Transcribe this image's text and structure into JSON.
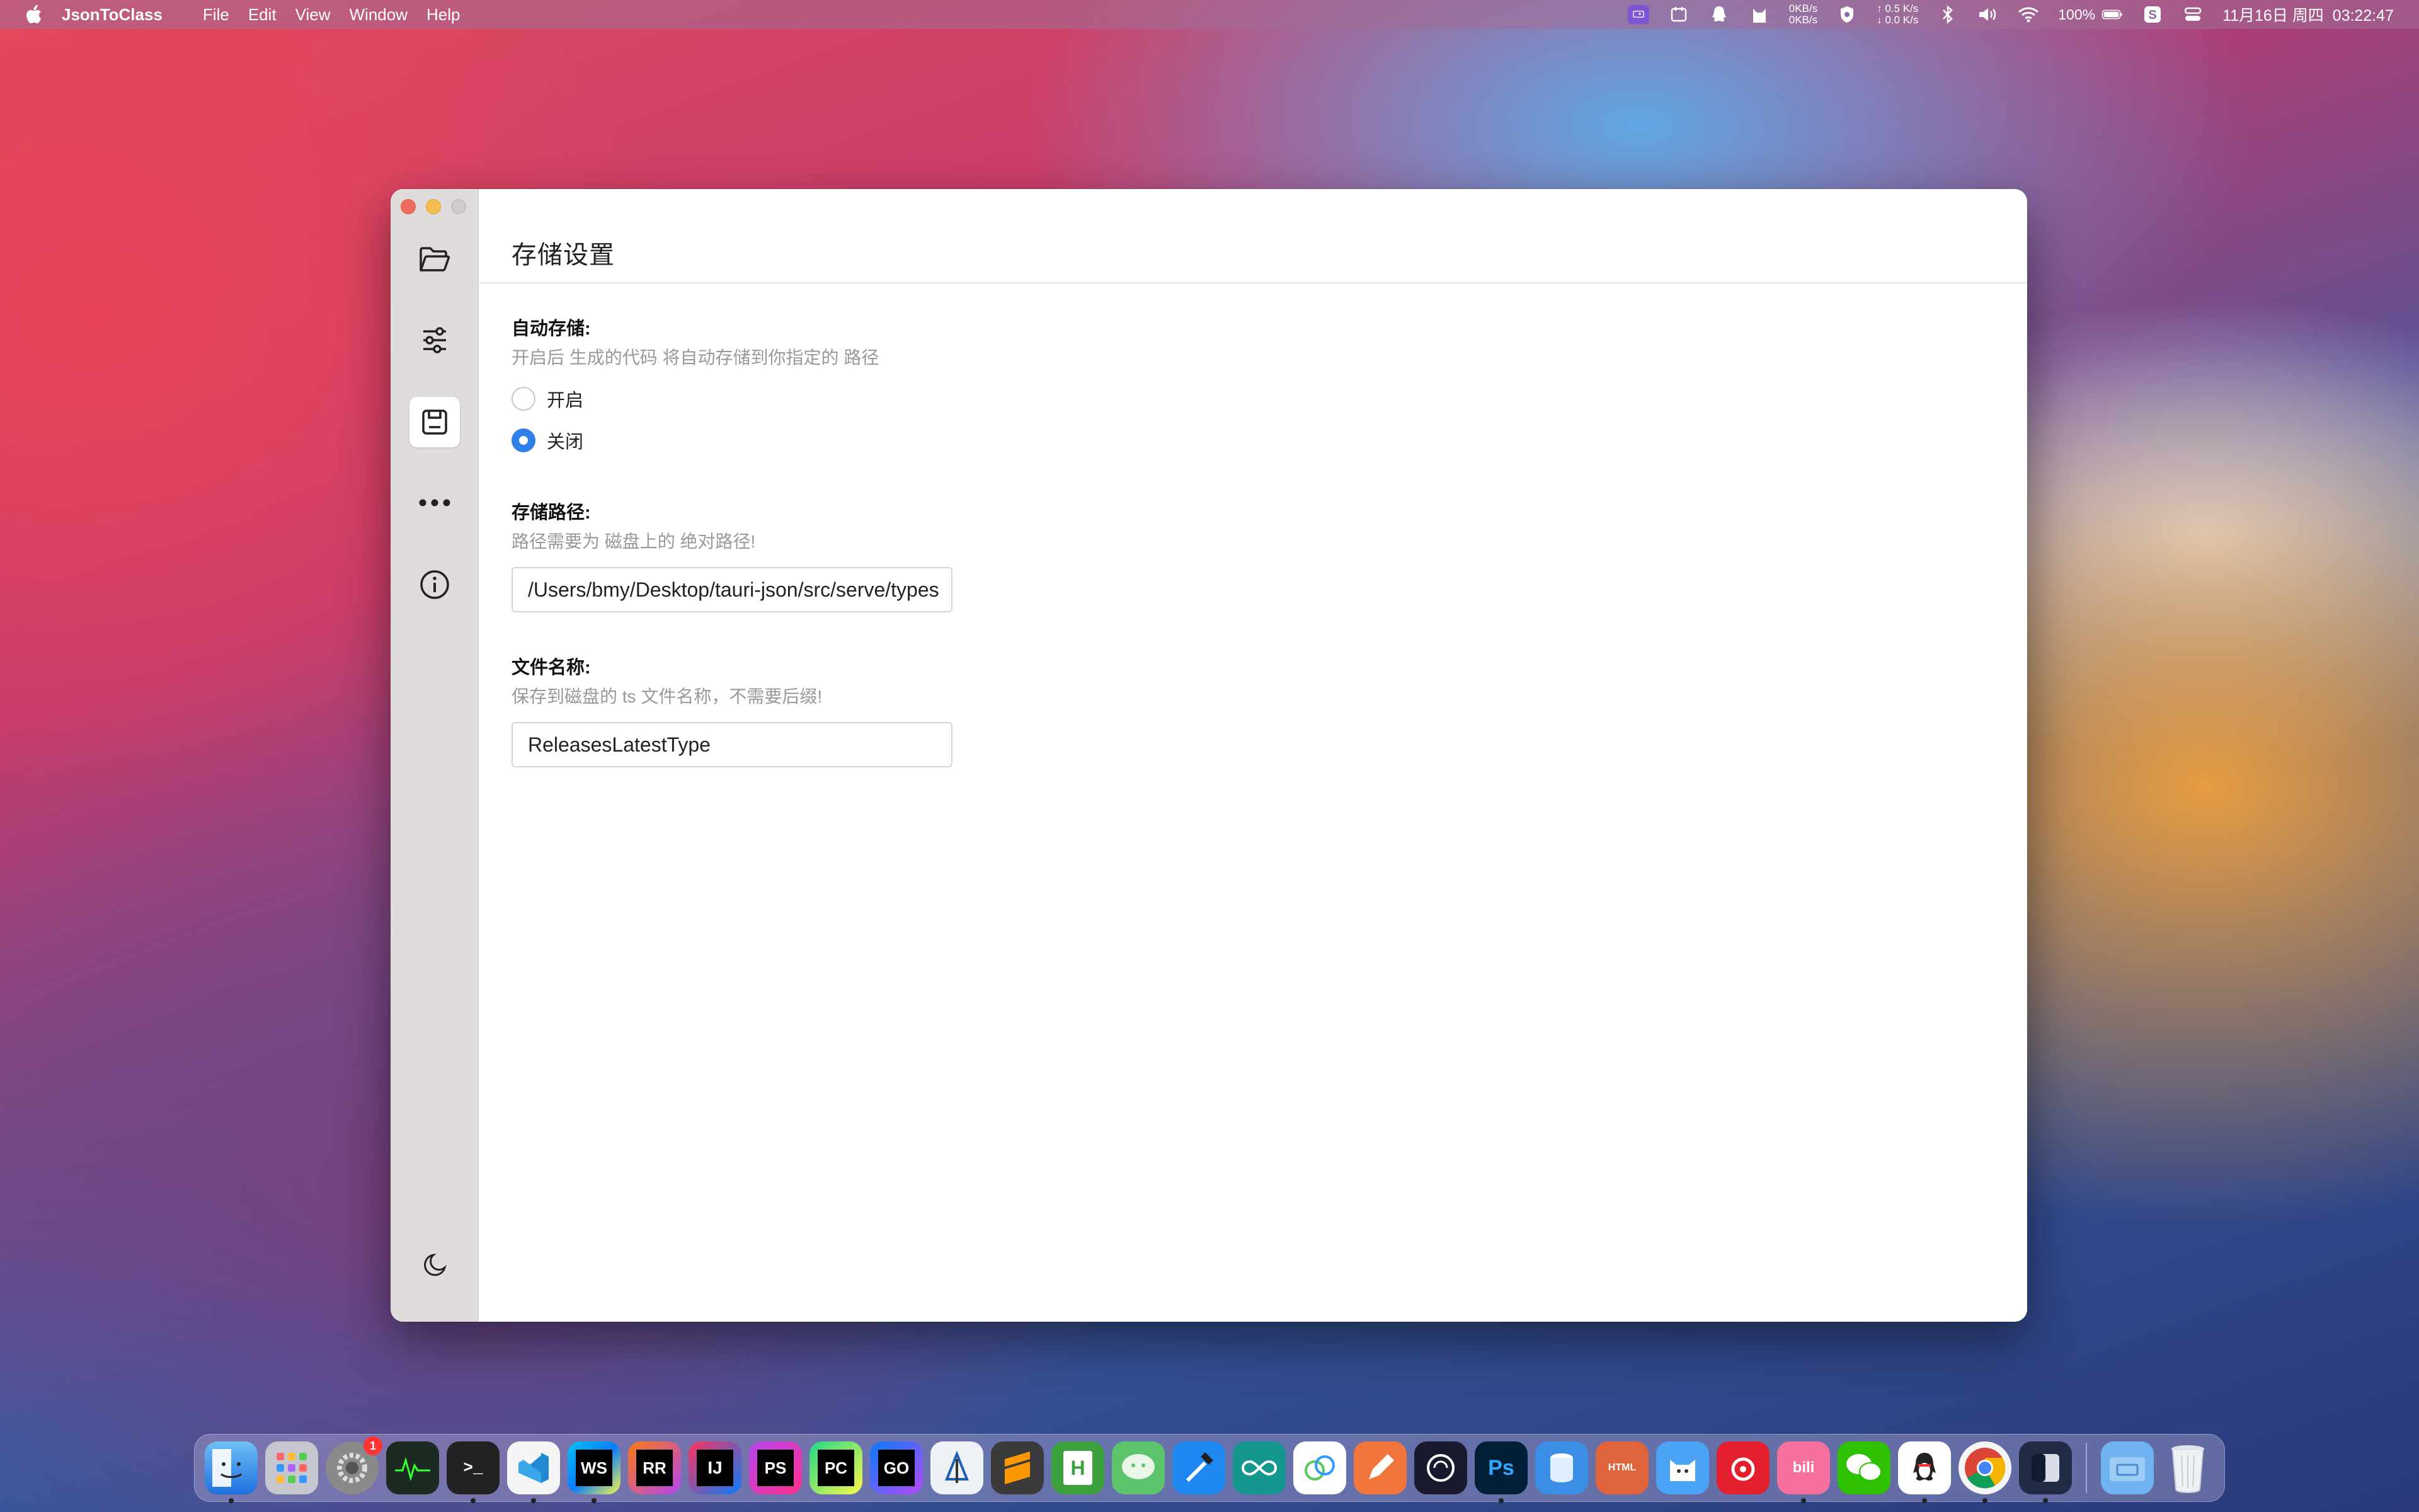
{
  "menubar": {
    "app_name": "JsonToClass",
    "items": [
      "File",
      "Edit",
      "View",
      "Window",
      "Help"
    ],
    "net_up": "0KB/s",
    "net_down": "0KB/s",
    "speed_up": "↑ 0.5 K/s",
    "speed_down": "↓ 0.0 K/s",
    "battery": "100%",
    "datetime": "11月16日 周四  03:22:47"
  },
  "sidebar": {
    "items": [
      {
        "name": "folder",
        "icon": "folder-icon",
        "active": false
      },
      {
        "name": "settings",
        "icon": "sliders-icon",
        "active": false
      },
      {
        "name": "storage",
        "icon": "save-icon",
        "active": true
      },
      {
        "name": "more",
        "icon": "more-icon",
        "active": false
      },
      {
        "name": "about",
        "icon": "info-icon",
        "active": false
      }
    ],
    "theme_icon": "moon-icon"
  },
  "page": {
    "title": "存储设置"
  },
  "auto_save": {
    "label": "自动存储:",
    "desc": "开启后 生成的代码 将自动存储到你指定的 路径",
    "options": [
      {
        "label": "开启",
        "checked": false
      },
      {
        "label": "关闭",
        "checked": true
      }
    ]
  },
  "save_path": {
    "label": "存储路径:",
    "desc": "路径需要为 磁盘上的 绝对路径!",
    "value": "/Users/bmy/Desktop/tauri-json/src/serve/types"
  },
  "file_name": {
    "label": "文件名称:",
    "desc": "保存到磁盘的 ts 文件名称，不需要后缀!",
    "value": "ReleasesLatestType"
  },
  "colors": {
    "accent": "#2f7fe8",
    "sidebar_bg": "#e0dcdc"
  },
  "dock": {
    "apps": [
      {
        "name": "finder",
        "label": ""
      },
      {
        "name": "launchpad",
        "label": ""
      },
      {
        "name": "system-preferences",
        "label": "",
        "badge": "1"
      },
      {
        "name": "activity-monitor",
        "label": ""
      },
      {
        "name": "terminal",
        "label": ">_"
      },
      {
        "name": "vscode",
        "label": ""
      },
      {
        "name": "webstorm",
        "label": "WS"
      },
      {
        "name": "rustrover",
        "label": "RR"
      },
      {
        "name": "intellij",
        "label": "IJ"
      },
      {
        "name": "phpstorm",
        "label": "PS"
      },
      {
        "name": "pycharm",
        "label": "PC"
      },
      {
        "name": "goland",
        "label": "GO"
      },
      {
        "name": "xcode-instruments",
        "label": ""
      },
      {
        "name": "sublime",
        "label": ""
      },
      {
        "name": "hbuilder",
        "label": "H"
      },
      {
        "name": "wechat-dev",
        "label": ""
      },
      {
        "name": "xcode",
        "label": ""
      },
      {
        "name": "arduino",
        "label": ""
      },
      {
        "name": "nova",
        "label": ""
      },
      {
        "name": "sketch",
        "label": ""
      },
      {
        "name": "chatgpt",
        "label": ""
      },
      {
        "name": "photoshop",
        "label": "Ps"
      },
      {
        "name": "db-tool",
        "label": ""
      },
      {
        "name": "html-app",
        "label": "HTML"
      },
      {
        "name": "cat-app",
        "label": ""
      },
      {
        "name": "netease-music",
        "label": ""
      },
      {
        "name": "bilibili",
        "label": "bili"
      },
      {
        "name": "wechat",
        "label": ""
      },
      {
        "name": "qq",
        "label": ""
      },
      {
        "name": "chrome",
        "label": ""
      },
      {
        "name": "screen-app",
        "label": ""
      },
      {
        "name": "downloads-folder",
        "label": ""
      },
      {
        "name": "trash",
        "label": ""
      }
    ]
  }
}
